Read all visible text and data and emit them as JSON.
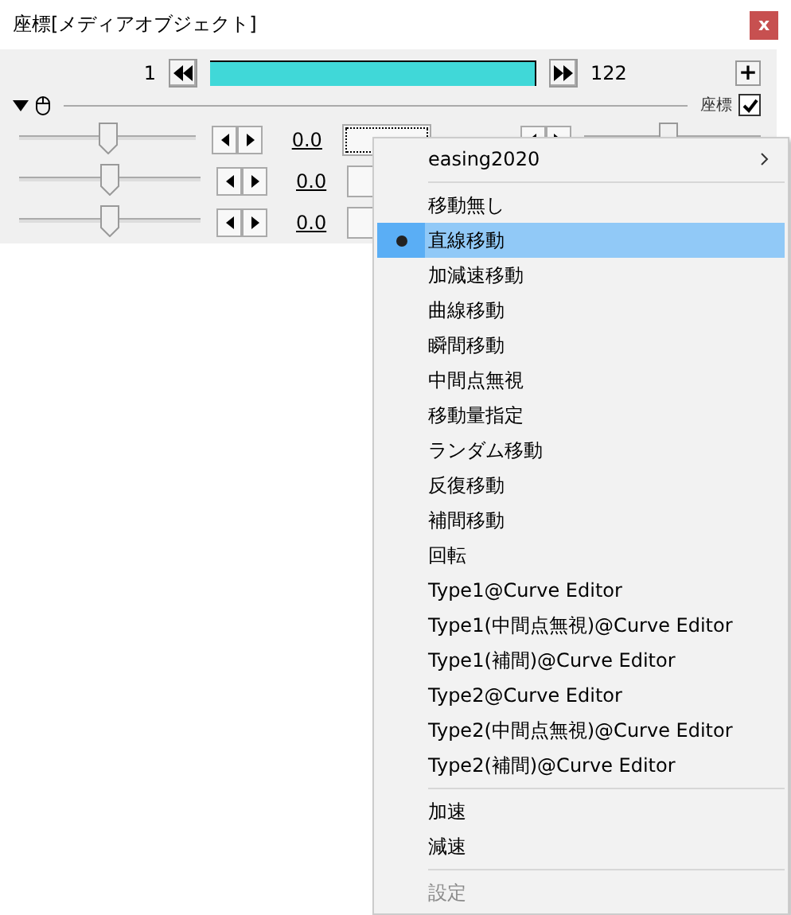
{
  "window": {
    "title": "座標[メディアオブジェクト]",
    "close": "x"
  },
  "timeline": {
    "start": "1",
    "end": "122",
    "level": 1,
    "add": "+"
  },
  "section": {
    "label": "座標",
    "checked": true,
    "expanded": true
  },
  "tracks": [
    {
      "level": 0.5,
      "value": "0.0",
      "focused": true,
      "end_slider": {
        "level": 0.48
      }
    },
    {
      "level": 0.5,
      "value": "0.0",
      "focused": false
    },
    {
      "level": 0.5,
      "value": "0.0",
      "focused": false
    }
  ],
  "menu": {
    "header": "easing2020",
    "groups": [
      [
        {
          "label": "移動無し",
          "selected": false,
          "disabled": false
        },
        {
          "label": "直線移動",
          "selected": true,
          "disabled": false
        },
        {
          "label": "加減速移動",
          "selected": false,
          "disabled": false
        },
        {
          "label": "曲線移動",
          "selected": false,
          "disabled": false
        },
        {
          "label": "瞬間移動",
          "selected": false,
          "disabled": false
        },
        {
          "label": "中間点無視",
          "selected": false,
          "disabled": false
        },
        {
          "label": "移動量指定",
          "selected": false,
          "disabled": false
        },
        {
          "label": "ランダム移動",
          "selected": false,
          "disabled": false
        },
        {
          "label": "反復移動",
          "selected": false,
          "disabled": false
        },
        {
          "label": "補間移動",
          "selected": false,
          "disabled": false
        },
        {
          "label": "回転",
          "selected": false,
          "disabled": false
        },
        {
          "label": "Type1@Curve Editor",
          "selected": false,
          "disabled": false
        },
        {
          "label": "Type1(中間点無視)@Curve Editor",
          "selected": false,
          "disabled": false
        },
        {
          "label": "Type1(補間)@Curve Editor",
          "selected": false,
          "disabled": false
        },
        {
          "label": "Type2@Curve Editor",
          "selected": false,
          "disabled": false
        },
        {
          "label": "Type2(中間点無視)@Curve Editor",
          "selected": false,
          "disabled": false
        },
        {
          "label": "Type2(補間)@Curve Editor",
          "selected": false,
          "disabled": false
        }
      ],
      [
        {
          "label": "加速",
          "selected": false,
          "disabled": false
        },
        {
          "label": "減速",
          "selected": false,
          "disabled": false
        }
      ],
      [
        {
          "label": "設定",
          "selected": false,
          "disabled": true
        }
      ]
    ]
  }
}
